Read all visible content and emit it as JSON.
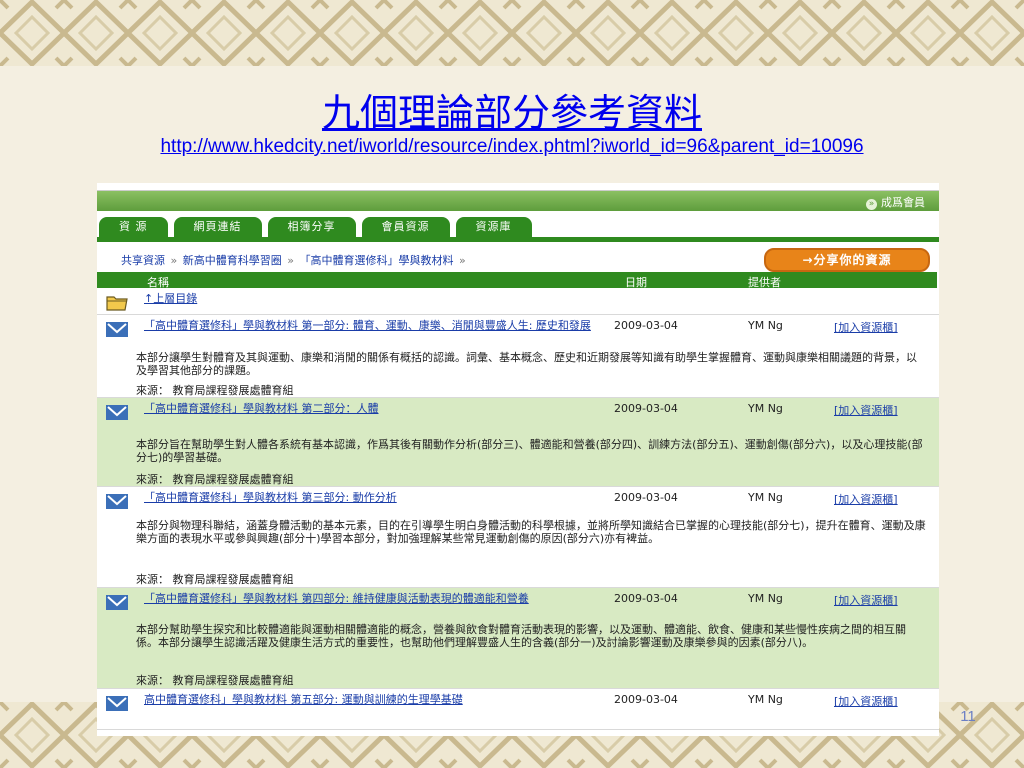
{
  "slide": {
    "title": "九個理論部分參考資料",
    "url": "http://www.hkedcity.net/iworld/resource/index.phtml?iworld_id=96&parent_id=10096",
    "page_number": "11"
  },
  "site": {
    "member_label": "成爲會員",
    "tabs": [
      {
        "label": "資 源"
      },
      {
        "label": "網頁連結"
      },
      {
        "label": "相簿分享"
      },
      {
        "label": "會員資源"
      },
      {
        "label": "資源庫"
      }
    ],
    "breadcrumb": [
      {
        "label": "共享資源"
      },
      {
        "label": "新高中體育科學習圈"
      },
      {
        "label": "「高中體育選修科」學與教材料"
      }
    ],
    "share_button": "分享你的資源",
    "columns": {
      "name": "名稱",
      "date": "日期",
      "provider": "提供者"
    },
    "up_link": "↑上層目錄",
    "resources": [
      {
        "title": "「高中體育選修科」學與教材料 第一部分: 體育、運動、康樂、消閒與豐盛人生: 歷史和發展",
        "date": "2009-03-04",
        "provider": "YM Ng",
        "add": "[加入資源櫃]",
        "description": "本部分讓學生對體育及其與運動、康樂和消閒的關係有概括的認識。詞彙、基本概念、歷史和近期發展等知識有助學生掌握體育、運動與康樂相關議題的背景，以及學習其他部分的課題。",
        "source": "來源： 教育局課程發展處體育組"
      },
      {
        "title": "「高中體育選修科」學與教材料 第二部分：人體",
        "date": "2009-03-04",
        "provider": "YM Ng",
        "add": "[加入資源櫃]",
        "description": "本部分旨在幫助學生對人體各系統有基本認識，作爲其後有關動作分析(部分三)、體適能和營養(部分四)、訓練方法(部分五)、運動創傷(部分六)，以及心理技能(部分七)的學習基礎。",
        "source": "來源： 教育局課程發展處體育組"
      },
      {
        "title": "「高中體育選修科」學與教材料 第三部分: 動作分析",
        "date": "2009-03-04",
        "provider": "YM Ng",
        "add": "[加入資源櫃]",
        "description": "本部分與物理科聯結，涵蓋身體活動的基本元素，目的在引導學生明白身體活動的科學根據，並將所學知識結合已掌握的心理技能(部分七)，提升在體育、運動及康樂方面的表現水平或參與興趣(部分十)學習本部分，對加強理解某些常見運動創傷的原因(部分六)亦有裨益。",
        "source": "來源： 教育局課程發展處體育組"
      },
      {
        "title": "「高中體育選修科」學與教材料 第四部分: 維持健康與活動表現的體適能和營養",
        "date": "2009-03-04",
        "provider": "YM Ng",
        "add": "[加入資源櫃]",
        "description": "本部分幫助學生探究和比較體適能與運動相關體適能的概念，營養與飲食對體育活動表現的影響，以及運動、體適能、飲食、健康和某些慢性疾病之間的相互關係。本部分讓學生認識活躍及健康生活方式的重要性，也幫助他們理解豐盛人生的含義(部分一)及討論影響運動及康樂參與的因素(部分八)。",
        "source": "來源： 教育局課程發展處體育組"
      },
      {
        "title": "高中體育選修科」學與教材料 第五部分: 運動與訓練的生理學基礎",
        "date": "2009-03-04",
        "provider": "YM Ng",
        "add": "[加入資源櫃]"
      }
    ]
  },
  "colors": {
    "green": "#2f8a1f",
    "light_green": "#d8eac3",
    "orange": "#e88419",
    "link": "#1a3da8"
  }
}
